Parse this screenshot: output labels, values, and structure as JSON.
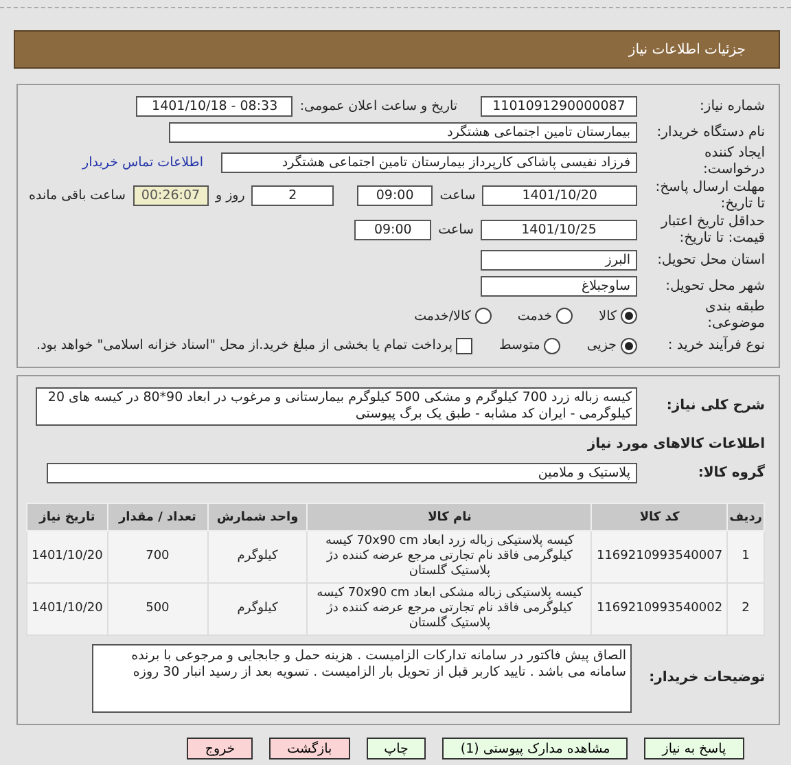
{
  "header": {
    "title": "جزئیات اطلاعات نیاز"
  },
  "info": {
    "need_number": {
      "label": "شماره نیاز:",
      "value": "1101091290000087"
    },
    "announce": {
      "label": "تاریخ و ساعت اعلان عمومی:",
      "value": "1401/10/18 - 08:33"
    },
    "buyer": {
      "label": "نام دستگاه خریدار:",
      "value": "بیمارستان تامین اجتماعی هشتگرد"
    },
    "creator": {
      "label": "ایجاد کننده درخواست:",
      "value": "فرزاد  نفیسی پاشاکی کارپرداز بیمارستان تامین اجتماعی هشتگرد",
      "link": "اطلاعات تماس خریدار"
    },
    "deadline": {
      "label": "مهلت ارسال پاسخ: تا تاریخ:",
      "date": "1401/10/20",
      "time_label": "ساعت",
      "time": "09:00",
      "days": "2",
      "days_label": "روز و",
      "remaining": "00:26:07",
      "remaining_label": "ساعت باقی مانده"
    },
    "validity": {
      "label": "حداقل تاریخ اعتبار قیمت: تا تاریخ:",
      "date": "1401/10/25",
      "time_label": "ساعت",
      "time": "09:00"
    },
    "province": {
      "label": "استان محل تحویل:",
      "value": "البرز"
    },
    "city": {
      "label": "شهر محل تحویل:",
      "value": "ساوجبلاغ"
    },
    "category": {
      "label": "طبقه بندی موضوعی:",
      "options": [
        {
          "label": "کالا",
          "selected": true
        },
        {
          "label": "خدمت",
          "selected": false
        },
        {
          "label": "کالا/خدمت",
          "selected": false
        }
      ]
    },
    "process": {
      "label": "نوع فرآیند خرید :",
      "options": [
        {
          "label": "جزیی",
          "selected": true
        },
        {
          "label": "متوسط",
          "selected": false
        }
      ],
      "payment": {
        "label": "پرداخت تمام یا بخشی از مبلغ خرید.از محل \"اسناد خزانه اسلامی\" خواهد بود.",
        "checked": false
      }
    }
  },
  "details": {
    "description": {
      "label": "شرح کلی نیاز:",
      "value": "کیسه زباله زرد  700 کیلوگرم و مشکی 500 کیلوگرم بیمارستانی  و مرغوب در  ابعاد  90*80   در کیسه های 20 کیلوگرمی - ایران کد مشابه - طبق یک برگ پیوستی"
    },
    "goods_title": "اطلاعات کالاهای مورد نیاز",
    "group": {
      "label": "گروه کالا:",
      "value": "پلاستیک و ملامین"
    },
    "table": {
      "columns": [
        "ردیف",
        "کد کالا",
        "نام کالا",
        "واحد شمارش",
        "تعداد / مقدار",
        "تاریخ نیاز"
      ],
      "rows": [
        [
          "1",
          "1169210993540007",
          "کیسه پلاستیکی زباله زرد ابعاد 70x90 cm کیسه کیلوگرمی فاقد نام تجارتی مرجع عرضه کننده دژ پلاستیک گلستان",
          "کیلوگرم",
          "700",
          "1401/10/20"
        ],
        [
          "2",
          "1169210993540002",
          "کیسه پلاستیکی زباله مشکی ابعاد 70x90 cm کیسه کیلوگرمی فاقد نام تجارتی مرجع عرضه کننده دژ پلاستیک گلستان",
          "کیلوگرم",
          "500",
          "1401/10/20"
        ]
      ]
    },
    "notes": {
      "label": "توضیحات خریدار:",
      "value": "الصاق پیش فاکتور در سامانه تدارکات الزامیست . هزینه حمل و جابجایی و مرجوعی با برنده سامانه می باشد . تایید کاربر قبل از تحویل بار الزامیست . تسویه بعد از رسید انبار 30 روزه"
    }
  },
  "buttons": [
    {
      "label": "پاسخ به نیاز",
      "kind": "action"
    },
    {
      "label": "مشاهده مدارک پیوستی (1)",
      "kind": "action"
    },
    {
      "label": "چاپ",
      "kind": "action"
    },
    {
      "label": "بازگشت",
      "kind": "exit"
    },
    {
      "label": "خروج",
      "kind": "exit"
    }
  ]
}
